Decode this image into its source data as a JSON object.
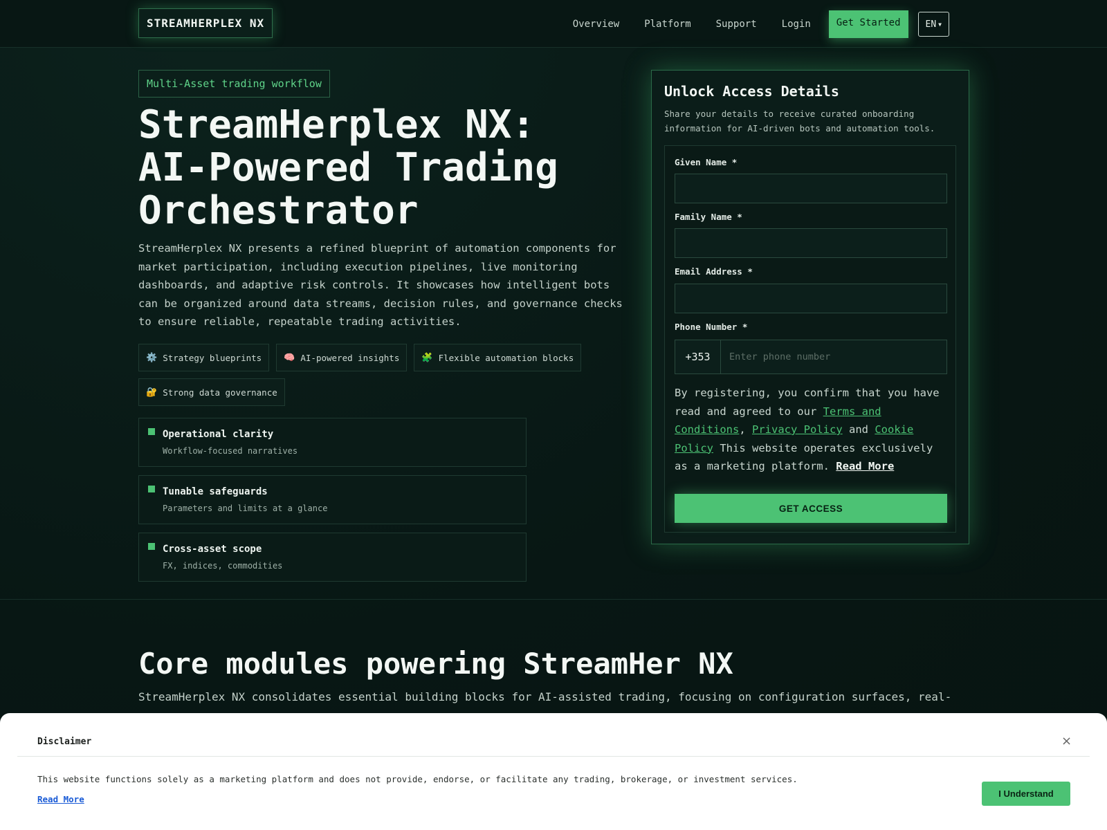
{
  "header": {
    "logo": "STREAMHERPLEX NX",
    "nav": [
      "Overview",
      "Platform",
      "Support",
      "Login"
    ],
    "cta": "Get Started",
    "lang": "EN"
  },
  "hero": {
    "eyebrow": "Multi-Asset trading workflow",
    "title_lines": [
      "StreamHerplex NX:",
      "AI-Powered Trading",
      "Orchestrator"
    ],
    "description": "StreamHerplex NX presents a refined blueprint of automation components for market participation, including execution pipelines, live monitoring dashboards, and adaptive risk controls. It showcases how intelligent bots can be organized around data streams, decision rules, and governance checks to ensure reliable, repeatable trading activities.",
    "chips": [
      {
        "icon": "gear-icon",
        "glyph": "⚙️",
        "label": "Strategy blueprints"
      },
      {
        "icon": "brain-icon",
        "glyph": "🧠",
        "label": "AI-powered insights"
      },
      {
        "icon": "puzzle-icon",
        "glyph": "🧩",
        "label": "Flexible automation blocks"
      },
      {
        "icon": "lock-icon",
        "glyph": "🔐",
        "label": "Strong data governance"
      }
    ],
    "features": [
      {
        "title": "Operational clarity",
        "subtitle": "Workflow-focused narratives"
      },
      {
        "title": "Tunable safeguards",
        "subtitle": "Parameters and limits at a glance"
      },
      {
        "title": "Cross-asset scope",
        "subtitle": "FX, indices, commodities"
      }
    ]
  },
  "form": {
    "title": "Unlock Access Details",
    "subtitle": "Share your details to receive curated onboarding information for AI-driven bots and automation tools.",
    "given_name_label": "Given Name *",
    "family_name_label": "Family Name *",
    "email_label": "Email Address *",
    "phone_label": "Phone Number *",
    "phone_code": "+353",
    "phone_placeholder": "Enter phone number",
    "consent_1": "By registering, you confirm that you have read and agreed to our ",
    "terms": "Terms and Conditions",
    "comma": ", ",
    "privacy": "Privacy Policy",
    "and": " and ",
    "cookie": "Cookie Policy",
    "consent_2": " This website operates exclusively as a marketing platform. ",
    "read_more": "Read More",
    "submit": "GET ACCESS"
  },
  "modules": {
    "title": "Core modules powering StreamHer NX",
    "description": "StreamHerplex NX consolidates essential building blocks for AI-assisted trading, focusing on configuration surfaces, real-"
  },
  "disclaimer": {
    "title": "Disclaimer",
    "close": "×",
    "text": "This website functions solely as a marketing platform and does not provide, endorse, or facilitate any trading, brokerage, or investment services.",
    "read_more": "Read More",
    "button": "I Understand"
  }
}
